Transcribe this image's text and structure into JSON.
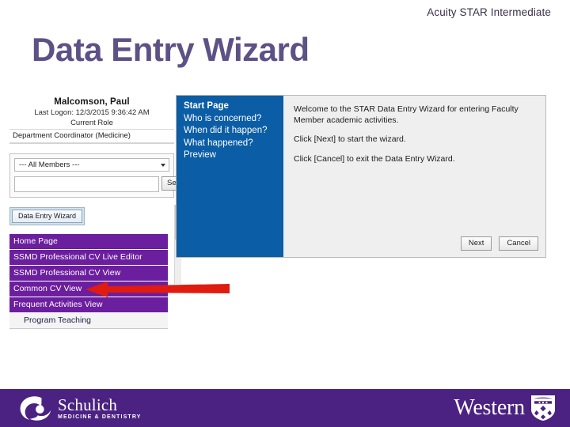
{
  "slide": {
    "header": "Acuity STAR Intermediate",
    "title": "Data Entry Wizard",
    "title_color": "#5e5186"
  },
  "app": {
    "user_panel": {
      "user_name": "Malcomson, Paul",
      "last_logon": "Last Logon: 12/3/2015 9:36:42 AM",
      "current_role_label": "Current Role",
      "current_role_value": "Department Coordinator (Medicine)"
    },
    "member_filter": {
      "selected_option": "--- All Members ---",
      "search_value": "",
      "search_placeholder": "",
      "search_button": "Search",
      "dropdown_icon": "chevron-down-icon"
    },
    "data_entry_wizard_button": "Data Entry Wizard",
    "nav": {
      "items": [
        {
          "label": "Home Page",
          "type": "primary"
        },
        {
          "label": "SSMD Professional CV Live Editor",
          "type": "primary"
        },
        {
          "label": "SSMD Professional CV View",
          "type": "primary"
        },
        {
          "label": "Common CV View",
          "type": "primary"
        },
        {
          "label": "Frequent Activities View",
          "type": "primary"
        },
        {
          "label": "Program Teaching",
          "type": "sub"
        }
      ],
      "accent_color": "#6B1E9E"
    },
    "wizard": {
      "panel_color": "#0B5DA5",
      "steps": [
        {
          "label": "Start Page",
          "active": true
        },
        {
          "label": "Who is concerned?",
          "active": false
        },
        {
          "label": "When did it happen?",
          "active": false
        },
        {
          "label": "What happened?",
          "active": false
        },
        {
          "label": "Preview",
          "active": false
        }
      ],
      "body_paragraphs": [
        "Welcome to the STAR Data Entry Wizard for entering Faculty Member academic activities.",
        "Click [Next] to start the wizard.",
        "Click [Cancel] to exit the Data Entry Wizard."
      ],
      "next_button": "Next",
      "cancel_button": "Cancel"
    },
    "callout": {
      "shape": "left-pointing-arrow",
      "color": "#E01B10"
    }
  },
  "footer": {
    "background_color": "#4B2282",
    "schulich": {
      "name": "Schulich",
      "subtitle": "MEDICINE & DENTISTRY",
      "mark": "schulich-swirl-logo"
    },
    "western": {
      "name": "Western",
      "mark": "western-shield-logo"
    }
  }
}
